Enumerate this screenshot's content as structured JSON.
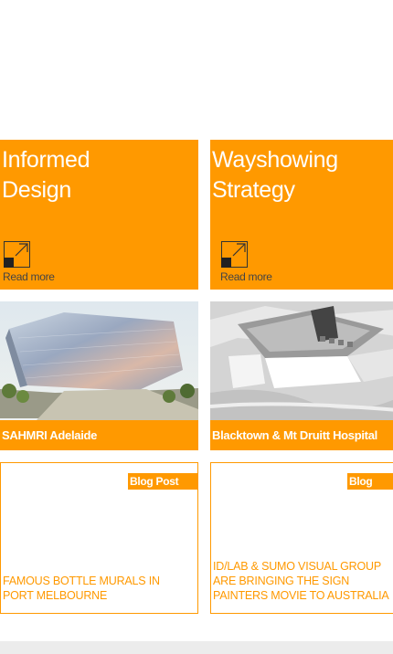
{
  "tiles": [
    {
      "title": "Informed\nDesign",
      "read_more": "Read more",
      "icon": "expand-arrow-icon"
    },
    {
      "title": "Wayshowing\nStrategy",
      "read_more": "Read more",
      "icon": "expand-arrow-icon"
    }
  ],
  "projects": [
    {
      "label": "SAHMRI Adelaide"
    },
    {
      "label": "Blacktown & Mt Druitt Hospital"
    }
  ],
  "blog_posts": [
    {
      "badge": "Blog Post",
      "title_lines": [
        "FAMOUS BOTTLE MURALS IN",
        "PORT MELBOURNE"
      ]
    },
    {
      "badge": "Blog Post",
      "title_lines": [
        "ID/LAB & SUMO VISUAL GROUP",
        "ARE BRINGING THE SIGN",
        "PAINTERS MOVIE TO AUSTRALIA"
      ]
    }
  ],
  "colors": {
    "accent": "#ff9900",
    "text_on_accent": "#ffffff",
    "footer": "#ececec"
  }
}
